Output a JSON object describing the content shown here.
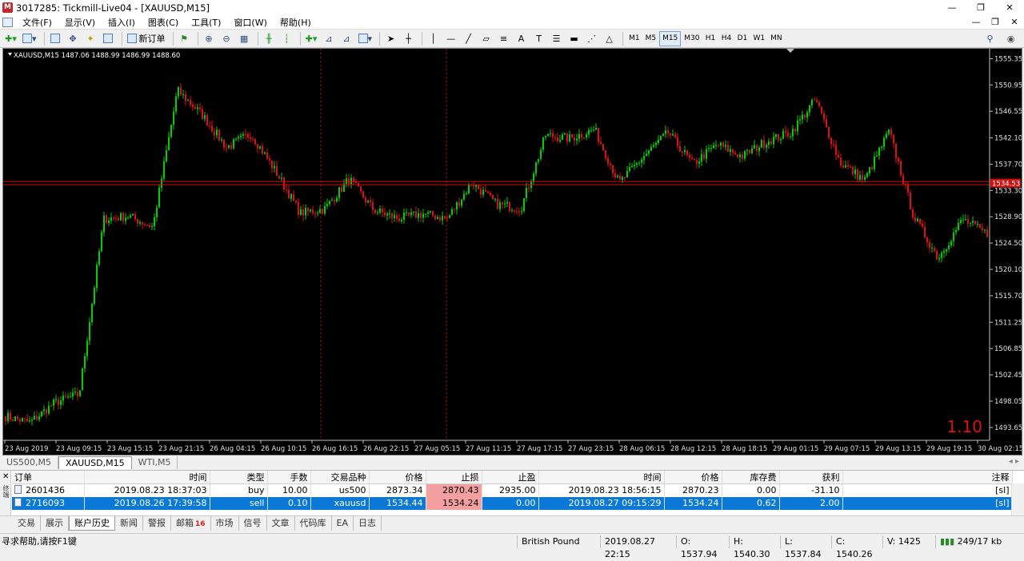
{
  "window": {
    "title": "3017285: Tickmill-Live04 - [XAUUSD,M15]",
    "app_icon": "mt4-app-icon"
  },
  "menu": [
    "文件(F)",
    "显示(V)",
    "插入(I)",
    "图表(C)",
    "工具(T)",
    "窗口(W)",
    "帮助(H)"
  ],
  "toolbar": {
    "new_order_label": "新订单",
    "timeframes": [
      "M1",
      "M5",
      "M15",
      "M30",
      "H1",
      "H4",
      "D1",
      "W1",
      "MN"
    ],
    "active_timeframe": "M15"
  },
  "chart": {
    "header": "XAUUSD,M15  1487.06 1488.99 1486.99 1488.60",
    "price_labels": [
      "1555.35",
      "1550.95",
      "1546.55",
      "1542.10",
      "1537.70",
      "1533.30",
      "1528.90",
      "1524.50",
      "1520.10",
      "1515.70",
      "1511.25",
      "1506.85",
      "1502.45",
      "1498.05",
      "1493.65"
    ],
    "current_price": "1534.53",
    "time_labels": [
      "23 Aug 2019",
      "23 Aug 09:15",
      "23 Aug 15:15",
      "23 Aug 21:15",
      "26 Aug 04:15",
      "26 Aug 10:15",
      "26 Aug 16:15",
      "26 Aug 22:15",
      "27 Aug 05:15",
      "27 Aug 11:15",
      "27 Aug 17:15",
      "27 Aug 23:15",
      "28 Aug 06:15",
      "28 Aug 12:15",
      "28 Aug 18:15",
      "29 Aug 01:15",
      "29 Aug 07:15",
      "29 Aug 13:15",
      "29 Aug 19:15",
      "30 Aug 02:15"
    ],
    "overlay_value": "1.10",
    "colors": {
      "bull": "#00d000",
      "bear": "#e01010",
      "background": "#000000",
      "level_line": "#d01010"
    },
    "key_closes": [
      1495.5,
      1494.5,
      1497.8,
      1499.2,
      1528.5,
      1529.0,
      1527.2,
      1550.0,
      1546.0,
      1540.5,
      1542.8,
      1536.5,
      1529.5,
      1530.2,
      1535.2,
      1530.0,
      1528.6,
      1529.4,
      1528.6,
      1534.6,
      1531.0,
      1530.3,
      1542.5,
      1542.0,
      1543.5,
      1534.5,
      1539.0,
      1543.0,
      1537.7,
      1541.0,
      1539.0,
      1541.5,
      1543.0,
      1548.5,
      1538.0,
      1535.0,
      1543.2,
      1529.0,
      1522.0,
      1528.5,
      1526.0
    ]
  },
  "chart_tabs": {
    "items": [
      "US500,M5",
      "XAUUSD,M15",
      "WTI,M5"
    ],
    "active": "XAUUSD,M15"
  },
  "terminal": {
    "side_label": "终端",
    "columns": [
      "订单",
      "时间",
      "类型",
      "手数",
      "交易品种",
      "价格",
      "止损",
      "止盈",
      "时间",
      "价格",
      "库存费",
      "获利",
      "注释"
    ],
    "rows": [
      {
        "order": "2601436",
        "open_time": "2019.08.23 18:37:03",
        "type": "buy",
        "lots": "10.00",
        "symbol": "us500",
        "price": "2873.34",
        "sl": "2870.43",
        "tp": "2935.00",
        "close_time": "2019.08.23 18:56:15",
        "close_price": "2870.23",
        "swap": "0.00",
        "profit": "-31.10",
        "comment": "[sl]"
      },
      {
        "order": "2716093",
        "open_time": "2019.08.26 17:39:58",
        "type": "sell",
        "lots": "0.10",
        "symbol": "xauusd",
        "price": "1534.44",
        "sl": "1534.24",
        "tp": "0.00",
        "close_time": "2019.08.27 09:15:29",
        "close_price": "1534.24",
        "swap": "0.62",
        "profit": "2.00",
        "comment": "[sl]"
      }
    ]
  },
  "terminal_tabs": {
    "items": [
      "交易",
      "展示",
      "账户历史",
      "新闻",
      "警报",
      "邮箱",
      "市场",
      "信号",
      "文章",
      "代码库",
      "EA",
      "日志"
    ],
    "active": "账户历史",
    "mail_badge": "16"
  },
  "status": {
    "help": "寻求帮助,请按F1键",
    "profile": "British Pound",
    "datetime": "2019.08.27 22:15",
    "open": "O: 1537.94",
    "high": "H: 1540.30",
    "low": "L: 1537.84",
    "close": "C: 1540.26",
    "volume": "V: 1425",
    "traffic": "249/17 kb"
  }
}
